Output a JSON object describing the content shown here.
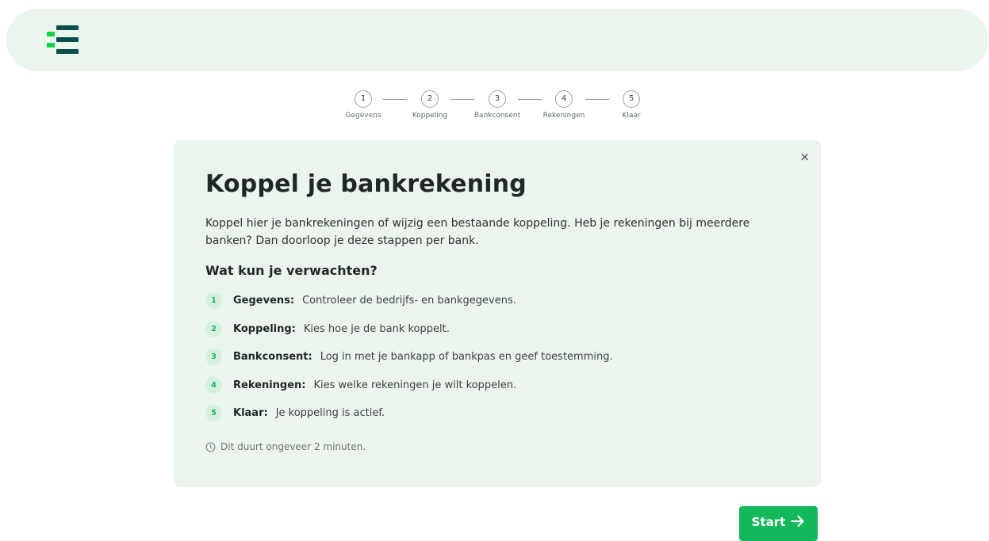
{
  "header": {
    "logo_icon": "brand-logo-icon",
    "brand_colors": [
      "#10d24a",
      "#0a4d4a"
    ]
  },
  "stepper": {
    "steps": [
      {
        "number": "1",
        "label": "Gegevens"
      },
      {
        "number": "2",
        "label": "Koppeling"
      },
      {
        "number": "3",
        "label": "Bankconsent"
      },
      {
        "number": "4",
        "label": "Rekeningen"
      },
      {
        "number": "5",
        "label": "Klaar"
      }
    ]
  },
  "card": {
    "close_label": "×",
    "title": "Koppel je bankrekening",
    "intro": "Koppel hier je bankrekeningen of wijzig een bestaande koppeling. Heb je rekeningen bij meerdere banken? Dan doorloop je deze stappen per bank.",
    "subtitle": "Wat kun je verwachten?",
    "items": [
      {
        "number": "1",
        "term": "Gegevens:",
        "text": "Controleer de bedrijfs- en bankgegevens."
      },
      {
        "number": "2",
        "term": "Koppeling:",
        "text": "Kies hoe je de bank koppelt."
      },
      {
        "number": "3",
        "term": "Bankconsent:",
        "text": "Log in met je bankapp of bankpas en geef toestemming."
      },
      {
        "number": "4",
        "term": "Rekeningen:",
        "text": "Kies welke rekeningen je wilt koppelen."
      },
      {
        "number": "5",
        "term": "Klaar:",
        "text": "Je koppeling is actief."
      }
    ],
    "duration_icon": "clock-icon",
    "duration": "Dit duurt ongeveer 2 minuten."
  },
  "actions": {
    "start_label": "Start",
    "start_icon": "arrow-right-icon",
    "accent": "#12b85a"
  }
}
